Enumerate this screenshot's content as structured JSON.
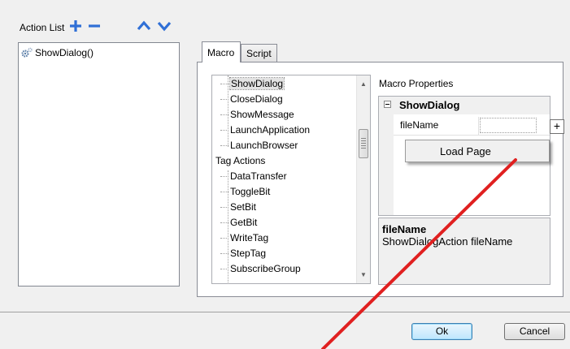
{
  "action_list": {
    "label": "Action List",
    "items": [
      {
        "label": "ShowDialog()"
      }
    ]
  },
  "toolbar": {
    "add_icon": "plus-icon",
    "remove_icon": "minus-icon",
    "up_icon": "chevron-up-icon",
    "down_icon": "chevron-down-icon",
    "accent": "#2f6fd6"
  },
  "tabs": [
    {
      "label": "Macro",
      "active": true
    },
    {
      "label": "Script",
      "active": false
    }
  ],
  "tree": {
    "items": [
      {
        "label": "ShowDialog",
        "kind": "child",
        "selected": true
      },
      {
        "label": "CloseDialog",
        "kind": "child"
      },
      {
        "label": "ShowMessage",
        "kind": "child"
      },
      {
        "label": "LaunchApplication",
        "kind": "child"
      },
      {
        "label": "LaunchBrowser",
        "kind": "child"
      },
      {
        "label": "Tag Actions",
        "kind": "group"
      },
      {
        "label": "DataTransfer",
        "kind": "child"
      },
      {
        "label": "ToggleBit",
        "kind": "child"
      },
      {
        "label": "SetBit",
        "kind": "child"
      },
      {
        "label": "GetBit",
        "kind": "child"
      },
      {
        "label": "WriteTag",
        "kind": "child"
      },
      {
        "label": "StepTag",
        "kind": "child"
      },
      {
        "label": "SubscribeGroup",
        "kind": "child"
      }
    ]
  },
  "macro_properties": {
    "label": "Macro Properties",
    "category": "ShowDialog",
    "property_name": "fileName",
    "property_value": "",
    "plus_label": "+",
    "dropdown_item": "Load Page",
    "description_title": "fileName",
    "description_text": "ShowDialogAction fileName"
  },
  "buttons": {
    "ok": "Ok",
    "cancel": "Cancel"
  },
  "annotation_color": "#e02020"
}
